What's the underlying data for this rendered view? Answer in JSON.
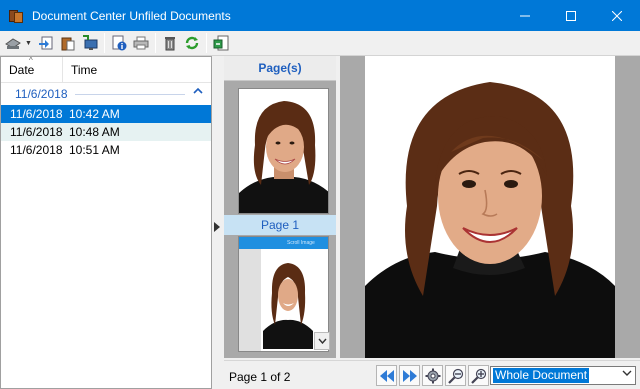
{
  "window": {
    "title": "Document Center Unfiled Documents",
    "controls": {
      "minimize": "—",
      "maximize": "☐",
      "close": "✕"
    }
  },
  "toolbar": {
    "icons": [
      "scanner-icon",
      "dropdown-arrow-icon",
      "import-icon",
      "paste-document-icon",
      "send-to-computer-icon",
      "document-info-icon",
      "print-icon",
      "delete-icon",
      "refresh-icon",
      "file-document-icon"
    ]
  },
  "list": {
    "columns": [
      "Date",
      "Time"
    ],
    "group": "11/6/2018",
    "rows": [
      {
        "date": "11/6/2018",
        "time": "10:42 AM"
      },
      {
        "date": "11/6/2018",
        "time": "10:48 AM"
      },
      {
        "date": "11/6/2018",
        "time": "10:51 AM"
      }
    ],
    "selected_index": 0
  },
  "thumbnails": {
    "header": "Page(s)",
    "page1_label": "Page 1",
    "mini_title": "Scroll Image"
  },
  "status": {
    "page_status": "Page 1 of 2",
    "zoom_value": "Whole Document"
  },
  "colors": {
    "titlebar": "#0078d7",
    "accent_blue": "#1f5fbf",
    "selection": "#0078d7"
  }
}
